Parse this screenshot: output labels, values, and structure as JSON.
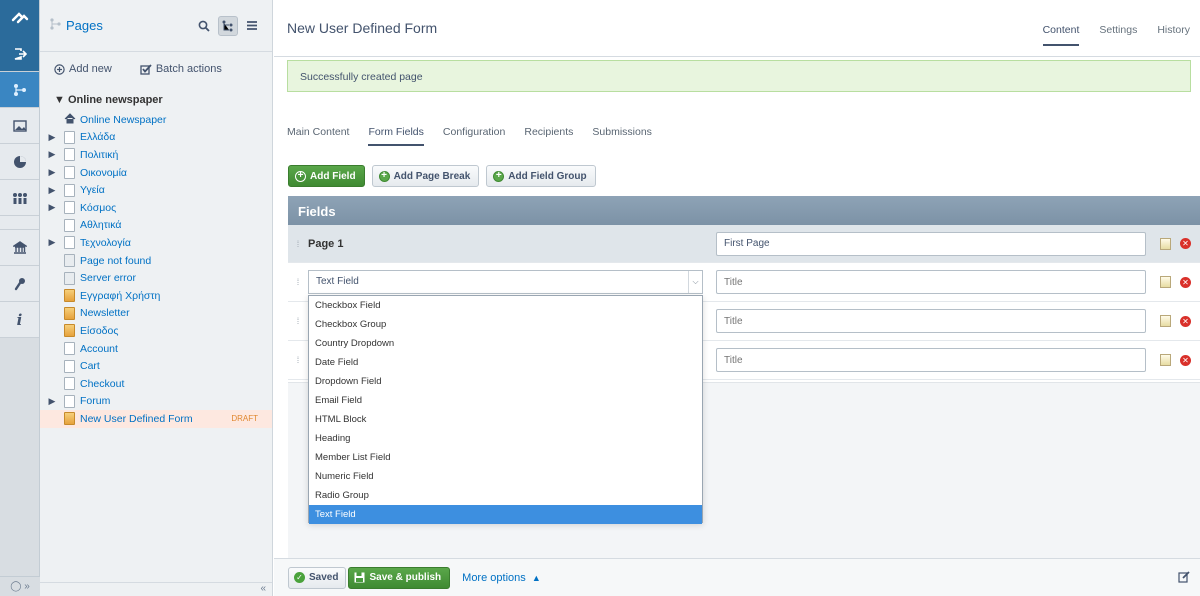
{
  "rail": {
    "icons": [
      "silverstripe-logo-icon",
      "logout-icon",
      "sitetree-icon",
      "files-icon",
      "reports-icon",
      "security-icon",
      "admin-icon",
      "help-icon",
      "info-icon"
    ],
    "bottom_label": "◯ »"
  },
  "tree": {
    "title": "Pages",
    "add_new": "Add new",
    "batch_actions": "Batch actions",
    "root": "Online newspaper",
    "collapse_label": "«",
    "items": [
      {
        "label": "Online Newspaper",
        "arrow": "",
        "icon": "home"
      },
      {
        "label": "Ελλάδα",
        "arrow": "▶",
        "icon": "page"
      },
      {
        "label": "Πολιτική",
        "arrow": "▶",
        "icon": "page"
      },
      {
        "label": "Οικονομία",
        "arrow": "▶",
        "icon": "page"
      },
      {
        "label": "Υγεία",
        "arrow": "▶",
        "icon": "page"
      },
      {
        "label": "Κόσμος",
        "arrow": "▶",
        "icon": "page"
      },
      {
        "label": "Αθλητικά",
        "arrow": "",
        "icon": "page"
      },
      {
        "label": "Τεχνολογία",
        "arrow": "▶",
        "icon": "page"
      },
      {
        "label": "Page not found",
        "arrow": "",
        "icon": "error"
      },
      {
        "label": "Server error",
        "arrow": "",
        "icon": "error"
      },
      {
        "label": "Εγγραφή Χρήστη",
        "arrow": "",
        "icon": "special"
      },
      {
        "label": "Newsletter",
        "arrow": "",
        "icon": "special"
      },
      {
        "label": "Είσοδος",
        "arrow": "",
        "icon": "special"
      },
      {
        "label": "Account",
        "arrow": "",
        "icon": "page"
      },
      {
        "label": "Cart",
        "arrow": "",
        "icon": "page"
      },
      {
        "label": "Checkout",
        "arrow": "",
        "icon": "page"
      },
      {
        "label": "Forum",
        "arrow": "▶",
        "icon": "page"
      },
      {
        "label": "New User Defined Form",
        "arrow": "",
        "icon": "special",
        "badge": "DRAFT",
        "selected": true
      }
    ]
  },
  "main": {
    "title": "New User Defined Form",
    "tabs": [
      {
        "label": "Content",
        "active": true
      },
      {
        "label": "Settings",
        "active": false
      },
      {
        "label": "History",
        "active": false
      }
    ],
    "alert": "Successfully created page",
    "subtabs": [
      {
        "label": "Main Content",
        "active": false
      },
      {
        "label": "Form Fields",
        "active": true
      },
      {
        "label": "Configuration",
        "active": false
      },
      {
        "label": "Recipients",
        "active": false
      },
      {
        "label": "Submissions",
        "active": false
      }
    ],
    "buttons": {
      "add_field": "Add Field",
      "add_page_break": "Add Page Break",
      "add_field_group": "Add Field Group"
    },
    "fields": {
      "heading": "Fields",
      "page_row": {
        "name": "Page 1",
        "title_value": "First Page"
      },
      "field_rows": [
        {
          "type": "Text Field",
          "title_placeholder": "Title"
        },
        {
          "type": "",
          "title_placeholder": "Title"
        },
        {
          "type": "",
          "title_placeholder": "Title"
        }
      ]
    },
    "dropdown_options": [
      "Checkbox Field",
      "Checkbox Group",
      "Country Dropdown",
      "Date Field",
      "Dropdown Field",
      "Email Field",
      "HTML Block",
      "Heading",
      "Member List Field",
      "Numeric Field",
      "Radio Group",
      "Text Field"
    ],
    "dropdown_selected": "Text Field",
    "footer": {
      "saved": "Saved",
      "save_publish": "Save & publish",
      "more_options": "More options"
    }
  }
}
